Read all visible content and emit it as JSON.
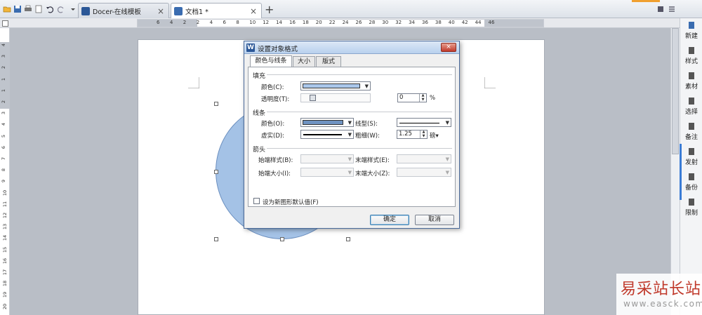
{
  "tabs": {
    "docer": "Docer-在线模板",
    "doc1": "文档1 *"
  },
  "ruler": {
    "h_numbers": [
      "6",
      "4",
      "2",
      "2",
      "4",
      "6",
      "8",
      "10",
      "12",
      "14",
      "16",
      "18",
      "20",
      "22",
      "24",
      "26",
      "28",
      "30",
      "32",
      "34",
      "36",
      "38",
      "40",
      "42",
      "44",
      "46"
    ],
    "v_numbers": [
      "4",
      "3",
      "2",
      "1",
      "1",
      "2",
      "3",
      "4",
      "5",
      "6",
      "7",
      "8",
      "9",
      "10",
      "11",
      "12",
      "13",
      "14",
      "15",
      "16",
      "17",
      "18",
      "19",
      "20",
      "21"
    ]
  },
  "sidebar": {
    "items": [
      {
        "label": "新建",
        "icon": "new-doc-icon"
      },
      {
        "label": "样式",
        "icon": "style-icon"
      },
      {
        "label": "素材",
        "icon": "material-icon"
      },
      {
        "label": "选择",
        "icon": "select-icon"
      },
      {
        "label": "备注",
        "icon": "note-icon"
      },
      {
        "label": "发射",
        "icon": "link-icon"
      },
      {
        "label": "备份",
        "icon": "backup-icon"
      },
      {
        "label": "限制",
        "icon": "restrict-icon"
      }
    ]
  },
  "dialog": {
    "title": "设置对象格式",
    "close_label": "×",
    "tabs": [
      "颜色与线条",
      "大小",
      "版式"
    ],
    "fill": {
      "section": "填充",
      "color_label": "颜色(C):",
      "transparency_label": "透明度(T):",
      "transparency_value": "0",
      "percent": "%"
    },
    "line": {
      "section": "线条",
      "color_label": "颜色(O):",
      "style_label": "线型(S):",
      "dash_label": "虚实(D):",
      "weight_label": "粗细(W):",
      "weight_value": "1.25",
      "weight_unit": "磅"
    },
    "arrow": {
      "section": "箭头",
      "begin_style_label": "始端样式(B):",
      "end_style_label": "末端样式(E):",
      "begin_size_label": "始端大小(I):",
      "end_size_label": "末端大小(Z):"
    },
    "default_checkbox": "设为新图形默认值(F)",
    "ok": "确定",
    "cancel": "取消"
  },
  "colors": {
    "fill_color": "#a9c6ea",
    "line_color": "#6f93c2",
    "shape_fill": "#a4c2e6"
  },
  "watermark": {
    "cn": "易采站长站",
    "en": "www.easck.com"
  }
}
